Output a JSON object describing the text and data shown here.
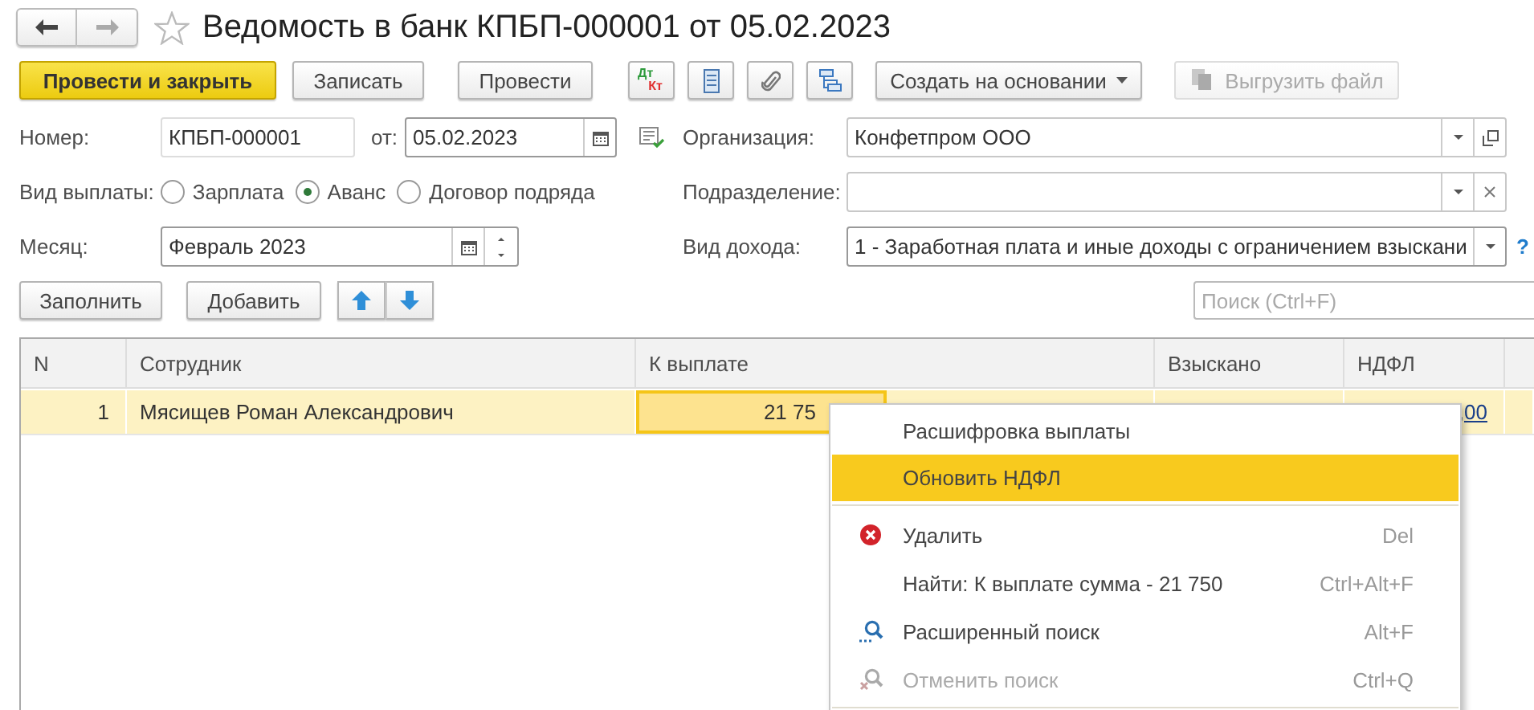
{
  "nav": {
    "back_enabled": true,
    "forward_enabled": false
  },
  "title": "Ведомость в банк КПБП-000001 от 05.02.2023",
  "favorite": false,
  "toolbar": {
    "primary": "Провести и закрыть",
    "buttons": [
      "Записать",
      "Провести"
    ],
    "dt_kt": {
      "top": "Дт",
      "bottom": "Кт"
    },
    "dropdown": "Создать на основании",
    "export": {
      "label": "Выгрузить файл",
      "disabled": true
    }
  },
  "form": {
    "number": {
      "label": "Номер:",
      "value": "КПБП-000001"
    },
    "date": {
      "label": "от:",
      "value": "05.02.2023"
    },
    "organization": {
      "label": "Организация:",
      "value": "Конфетпром ООО"
    },
    "payment_type": {
      "label": "Вид выплаты:",
      "options": [
        {
          "label": "Зарплата",
          "selected": false
        },
        {
          "label": "Аванс",
          "selected": true
        },
        {
          "label": "Договор подряда",
          "selected": false
        }
      ]
    },
    "subdivision": {
      "label": "Подразделение:"
    },
    "month": {
      "label": "Месяц:",
      "value": "Февраль 2023"
    },
    "income_type": {
      "label": "Вид дохода:",
      "value": "1 - Заработная плата и иные доходы с ограничением взыскани",
      "help": "?"
    }
  },
  "table_toolbar": {
    "buttons": [
      "Заполнить",
      "Добавить"
    ],
    "search": {
      "placeholder": "Поиск (Ctrl+F)"
    }
  },
  "table": {
    "columns": [
      "N",
      "Сотрудник",
      "К выплате",
      "Взыскано",
      "НДФЛ"
    ],
    "rows": [
      {
        "n": "1",
        "employee": "Мясищев Роман Александрович",
        "to_pay": "21 75",
        "ndfl": ",00",
        "selected": true
      }
    ]
  },
  "context_menu": [
    {
      "kind": "plain",
      "label": "Расшифровка выплаты",
      "selected": false,
      "disabled": false
    },
    {
      "kind": "plain",
      "label": "Обновить НДФЛ",
      "selected": true,
      "disabled": false
    },
    {
      "kind": "separator"
    },
    {
      "kind": "delete",
      "label": "Удалить",
      "shortcut": "Del",
      "selected": false,
      "disabled": false
    },
    {
      "kind": "plain",
      "label": "Найти: К выплате сумма - 21 750",
      "shortcut": "Ctrl+Alt+F",
      "selected": false,
      "disabled": false
    },
    {
      "kind": "search",
      "label": "Расширенный поиск",
      "shortcut": "Alt+F",
      "selected": false,
      "disabled": false
    },
    {
      "kind": "cancel_search",
      "label": "Отменить поиск",
      "shortcut": "Ctrl+Q",
      "selected": false,
      "disabled": true
    },
    {
      "kind": "separator"
    }
  ]
}
